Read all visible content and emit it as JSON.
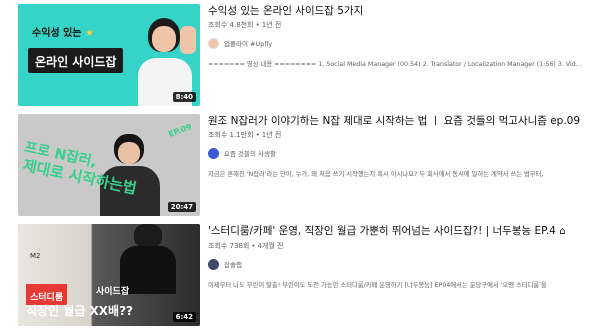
{
  "videos": [
    {
      "title": "수익성 있는 온라인 사이드잡 5가지",
      "views": "조회수 4.8천회",
      "age": "1년 전",
      "channel": "업플라이 #Upfly",
      "description": "======= 영상 내용 ======== 1. Social Media Manager (00:54) 2. Translator / Localization Manager (1:56) 3. Video Editor (3:10) 4.",
      "duration": "8:40",
      "thumb_text": [
        "수익성 있는",
        "온라인 사이드잡"
      ],
      "thumb_star": "★",
      "bg_color": "#35d3c8",
      "accent_color": "#f5d142"
    },
    {
      "title": "원조 N잡러가 이야기하는 N잡 제대로 시작하는 법 ㅣ 요즘 것들의 먹고사니즘 ep.09",
      "views": "조회수 1.1만회",
      "age": "1년 전",
      "channel": "요즘 것들의 사생활",
      "description": "지금은 흔해진 'N잡러'라는 단어, 누가, 왜 처음 쓰기 시작했는지 혹시 아시나요? 두 회사에서 동시에 일하는 계약서 쓰는 법부터,",
      "duration": "20:47",
      "thumb_text": [
        "프로 N잡러,",
        "제대로 시작하는법"
      ],
      "thumb_badge": "EP.09",
      "bg_color": "#c7c7c7",
      "accent_color": "#36d08b"
    },
    {
      "title": "'스터디룸/카페' 운영, 직장인 월급 가뿐히 뛰어넘는 사이드잡?! | 너두봉능 EP.4",
      "views": "조회수 738회",
      "age": "4개월 전",
      "channel": "잡솔랩",
      "description": "이제부터 나도 부린이 탈출! 부린이도 도전 가능한 스터디룸/카페 운영하기 [너두봉능] EP04에서는 운당구에서 '오멘 스터디룸'을",
      "duration": "6:42",
      "thumb_text": [
        "스터디룸",
        "사이드잡",
        "직장인 월급 XX배??"
      ],
      "thumb_label": "M2",
      "bg_color": "#3a3a3a",
      "accent_color": "#e53935"
    }
  ],
  "icons": {
    "home": "⌂"
  }
}
